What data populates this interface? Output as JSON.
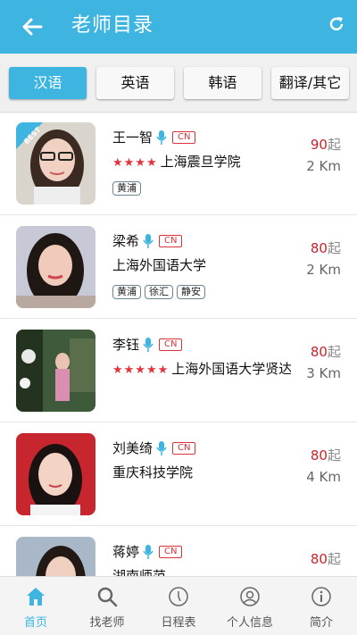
{
  "header": {
    "title": "老师目录",
    "back_icon": "arrow-left-icon",
    "refresh_icon": "refresh-icon",
    "bg_color": "#3db5e0"
  },
  "tabs": [
    {
      "label": "汉语",
      "active": true
    },
    {
      "label": "英语",
      "active": false
    },
    {
      "label": "韩语",
      "active": false
    },
    {
      "label": "翻译/其它",
      "active": false
    }
  ],
  "teachers": [
    {
      "name": "王一智",
      "lang": "CN",
      "rating": "★★★★",
      "school": "上海震旦学院",
      "tags": [
        "黄浦"
      ],
      "price": "90",
      "price_suffix": "起",
      "distance": "2 Km",
      "badge": "BEST"
    },
    {
      "name": "梁希",
      "lang": "CN",
      "rating": "",
      "school": "上海外国语大学",
      "tags": [
        "黄浦",
        "徐汇",
        "静安"
      ],
      "price": "80",
      "price_suffix": "起",
      "distance": "2 Km"
    },
    {
      "name": "李钰",
      "lang": "CN",
      "rating": "★★★★★",
      "school": "上海外国语大学贤达",
      "tags": [],
      "price": "80",
      "price_suffix": "起",
      "distance": "3 Km"
    },
    {
      "name": "刘美绮",
      "lang": "CN",
      "rating": "",
      "school": "重庆科技学院",
      "tags": [],
      "price": "80",
      "price_suffix": "起",
      "distance": "4 Km"
    },
    {
      "name": "蒋婷",
      "lang": "CN",
      "rating": "",
      "school": "湖南师范",
      "tags": [],
      "price": "80",
      "price_suffix": "起",
      "distance": ""
    }
  ],
  "bottom_nav": [
    {
      "label": "首页",
      "icon": "home-icon",
      "active": true
    },
    {
      "label": "找老师",
      "icon": "search-icon",
      "active": false
    },
    {
      "label": "日程表",
      "icon": "clock-icon",
      "active": false
    },
    {
      "label": "个人信息",
      "icon": "user-icon",
      "active": false
    },
    {
      "label": "简介",
      "icon": "info-icon",
      "active": false
    }
  ]
}
